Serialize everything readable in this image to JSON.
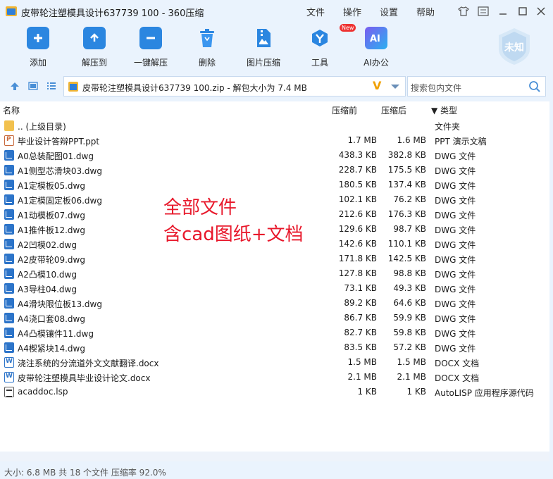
{
  "window": {
    "title": "皮带轮注塑模具设计637739  100 - 360压缩",
    "menu": [
      "文件",
      "操作",
      "设置",
      "帮助"
    ]
  },
  "toolbar": {
    "items": [
      {
        "label": "添加",
        "icon": "add-icon"
      },
      {
        "label": "解压到",
        "icon": "extract-to-icon"
      },
      {
        "label": "一键解压",
        "icon": "one-click-extract-icon"
      },
      {
        "label": "删除",
        "icon": "delete-icon"
      },
      {
        "label": "图片压缩",
        "icon": "image-compress-icon"
      },
      {
        "label": "工具",
        "icon": "tools-icon"
      },
      {
        "label": "AI办公",
        "icon": "ai-office-icon"
      }
    ],
    "new_badge": "New",
    "user_label": "未知"
  },
  "address": {
    "path": "皮带轮注塑模具设计637739   100.zip - 解包大小为 7.4 MB",
    "search_placeholder": "搜索包内文件"
  },
  "columns": {
    "name": "名称",
    "packed": "压缩前",
    "compressed": "压缩后",
    "type": "▼ 类型"
  },
  "files": [
    {
      "name": ".. (上级目录)",
      "before": "",
      "after": "",
      "type": "文件夹",
      "kind": "folder"
    },
    {
      "name": "毕业设计答辩PPT.ppt",
      "before": "1.7 MB",
      "after": "1.6 MB",
      "type": "PPT 演示文稿",
      "kind": "ppt"
    },
    {
      "name": "A0总装配图01.dwg",
      "before": "438.3 KB",
      "after": "382.8 KB",
      "type": "DWG 文件",
      "kind": "dwg"
    },
    {
      "name": "A1侧型芯滑块03.dwg",
      "before": "228.7 KB",
      "after": "175.5 KB",
      "type": "DWG 文件",
      "kind": "dwg"
    },
    {
      "name": "A1定模板05.dwg",
      "before": "180.5 KB",
      "after": "137.4 KB",
      "type": "DWG 文件",
      "kind": "dwg"
    },
    {
      "name": "A1定模固定板06.dwg",
      "before": "102.1 KB",
      "after": "76.2 KB",
      "type": "DWG 文件",
      "kind": "dwg"
    },
    {
      "name": "A1动模板07.dwg",
      "before": "212.6 KB",
      "after": "176.3 KB",
      "type": "DWG 文件",
      "kind": "dwg"
    },
    {
      "name": "A1推件板12.dwg",
      "before": "129.6 KB",
      "after": "98.7 KB",
      "type": "DWG 文件",
      "kind": "dwg"
    },
    {
      "name": "A2凹模02.dwg",
      "before": "142.6 KB",
      "after": "110.1 KB",
      "type": "DWG 文件",
      "kind": "dwg"
    },
    {
      "name": "A2皮带轮09.dwg",
      "before": "171.8 KB",
      "after": "142.5 KB",
      "type": "DWG 文件",
      "kind": "dwg"
    },
    {
      "name": "A2凸模10.dwg",
      "before": "127.8 KB",
      "after": "98.8 KB",
      "type": "DWG 文件",
      "kind": "dwg"
    },
    {
      "name": "A3导柱04.dwg",
      "before": "73.1 KB",
      "after": "49.3 KB",
      "type": "DWG 文件",
      "kind": "dwg"
    },
    {
      "name": "A4滑块限位板13.dwg",
      "before": "89.2 KB",
      "after": "64.6 KB",
      "type": "DWG 文件",
      "kind": "dwg"
    },
    {
      "name": "A4浇口套08.dwg",
      "before": "86.7 KB",
      "after": "59.9 KB",
      "type": "DWG 文件",
      "kind": "dwg"
    },
    {
      "name": "A4凸模镶件11.dwg",
      "before": "82.7 KB",
      "after": "59.8 KB",
      "type": "DWG 文件",
      "kind": "dwg"
    },
    {
      "name": "A4楔紧块14.dwg",
      "before": "83.5 KB",
      "after": "57.2 KB",
      "type": "DWG 文件",
      "kind": "dwg"
    },
    {
      "name": "浇注系统的分流道外文文献翻译.docx",
      "before": "1.5 MB",
      "after": "1.5 MB",
      "type": "DOCX 文档",
      "kind": "doc"
    },
    {
      "name": "皮带轮注塑模具毕业设计论文.docx",
      "before": "2.1 MB",
      "after": "2.1 MB",
      "type": "DOCX 文档",
      "kind": "doc"
    },
    {
      "name": "acaddoc.lsp",
      "before": "1 KB",
      "after": "1 KB",
      "type": "AutoLISP 应用程序源代码",
      "kind": "lsp"
    }
  ],
  "overlay": {
    "line1": "全部文件",
    "line2": "含cad图纸+文档"
  },
  "status": "大小: 6.8 MB 共 18 个文件 压缩率 92.0%"
}
